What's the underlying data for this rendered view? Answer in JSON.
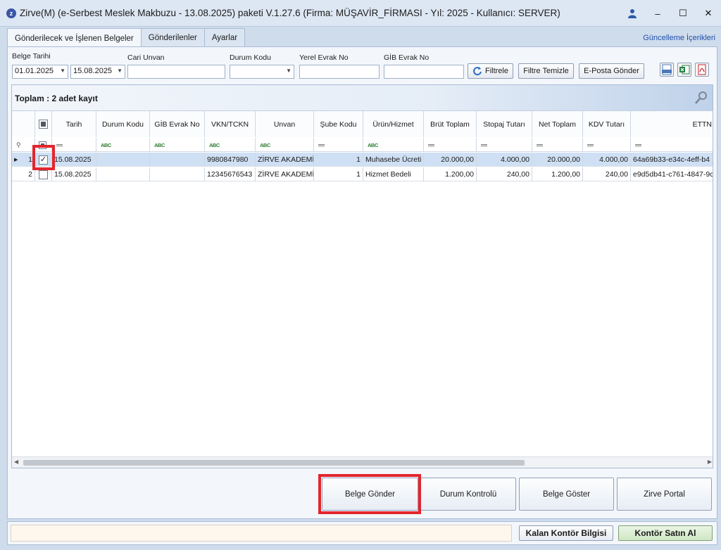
{
  "window": {
    "title": "Zirve(M)  (e-Serbest Meslek Makbuzu - 13.08.2025) paketi V.1.27.6 (Firma: MÜŞAVİR_FİRMASI - Yıl: 2025 - Kullanıcı: SERVER)",
    "minimize": "–",
    "maximize": "☐",
    "close": "✕",
    "app_icon_letter": "z"
  },
  "tabs": [
    {
      "label": "Gönderilecek ve İşlenen Belgeler",
      "active": true
    },
    {
      "label": "Gönderilenler",
      "active": false
    },
    {
      "label": "Ayarlar",
      "active": false
    }
  ],
  "update_link": "Güncelleme İçerikleri",
  "filters": {
    "belge_tarihi_label": "Belge Tarihi",
    "date_from": "01.01.2025",
    "date_to": "15.08.2025",
    "cari_unvan_label": "Cari Unvan",
    "cari_unvan_value": "",
    "durum_kodu_label": "Durum Kodu",
    "durum_kodu_value": "",
    "yerel_evrak_label": "Yerel Evrak No",
    "yerel_evrak_value": "",
    "gib_evrak_label": "GİB Evrak No",
    "gib_evrak_value": "",
    "filtrele": "Filtrele",
    "filtre_temizle": "Filtre Temizle",
    "eposta_gonder": "E-Posta Gönder"
  },
  "grid": {
    "group_text": "Toplam : 2 adet kayıt",
    "columns": [
      "Tarih",
      "Durum Kodu",
      "GİB Evrak No",
      "VKN/TCKN",
      "Unvan",
      "Şube Kodu",
      "Ürün/Hizmet",
      "Brüt Toplam",
      "Stopaj Tutarı",
      "Net Toplam",
      "KDV Tutarı",
      "ETTN"
    ],
    "filter_abc": "ABC",
    "rows": [
      {
        "no": "1",
        "checked": true,
        "tarih": "15.08.2025",
        "durum": "",
        "gib": "",
        "vkn": "9980847980",
        "unvan": "ZİRVE AKADEMİ",
        "sube": "1",
        "urun": "Muhasebe Ücreti",
        "brut": "20.000,00",
        "stopaj": "4.000,00",
        "net": "20.000,00",
        "kdv": "4.000,00",
        "ettn": "64a69b33-e34c-4eff-b4"
      },
      {
        "no": "2",
        "checked": false,
        "tarih": "15.08.2025",
        "durum": "",
        "gib": "",
        "vkn": "12345676543",
        "unvan": "ZİRVE AKADEMİ",
        "sube": "1",
        "urun": "Hizmet Bedeli",
        "brut": "1.200,00",
        "stopaj": "240,00",
        "net": "1.200,00",
        "kdv": "240,00",
        "ettn": "e9d5db41-c761-4847-9c"
      }
    ]
  },
  "actions": {
    "belge_gonder": "Belge Gönder",
    "durum_kontrolu": "Durum Kontrolü",
    "belge_goster": "Belge Göster",
    "zirve_portal": "Zirve Portal"
  },
  "status": {
    "kalan_kontor": "Kalan Kontör Bilgisi",
    "kontor_satin_al": "Kontör Satın Al"
  },
  "colors": {
    "highlight": "#e3262d",
    "selected_row": "#cfe0f4",
    "link": "#1d4fa8"
  }
}
